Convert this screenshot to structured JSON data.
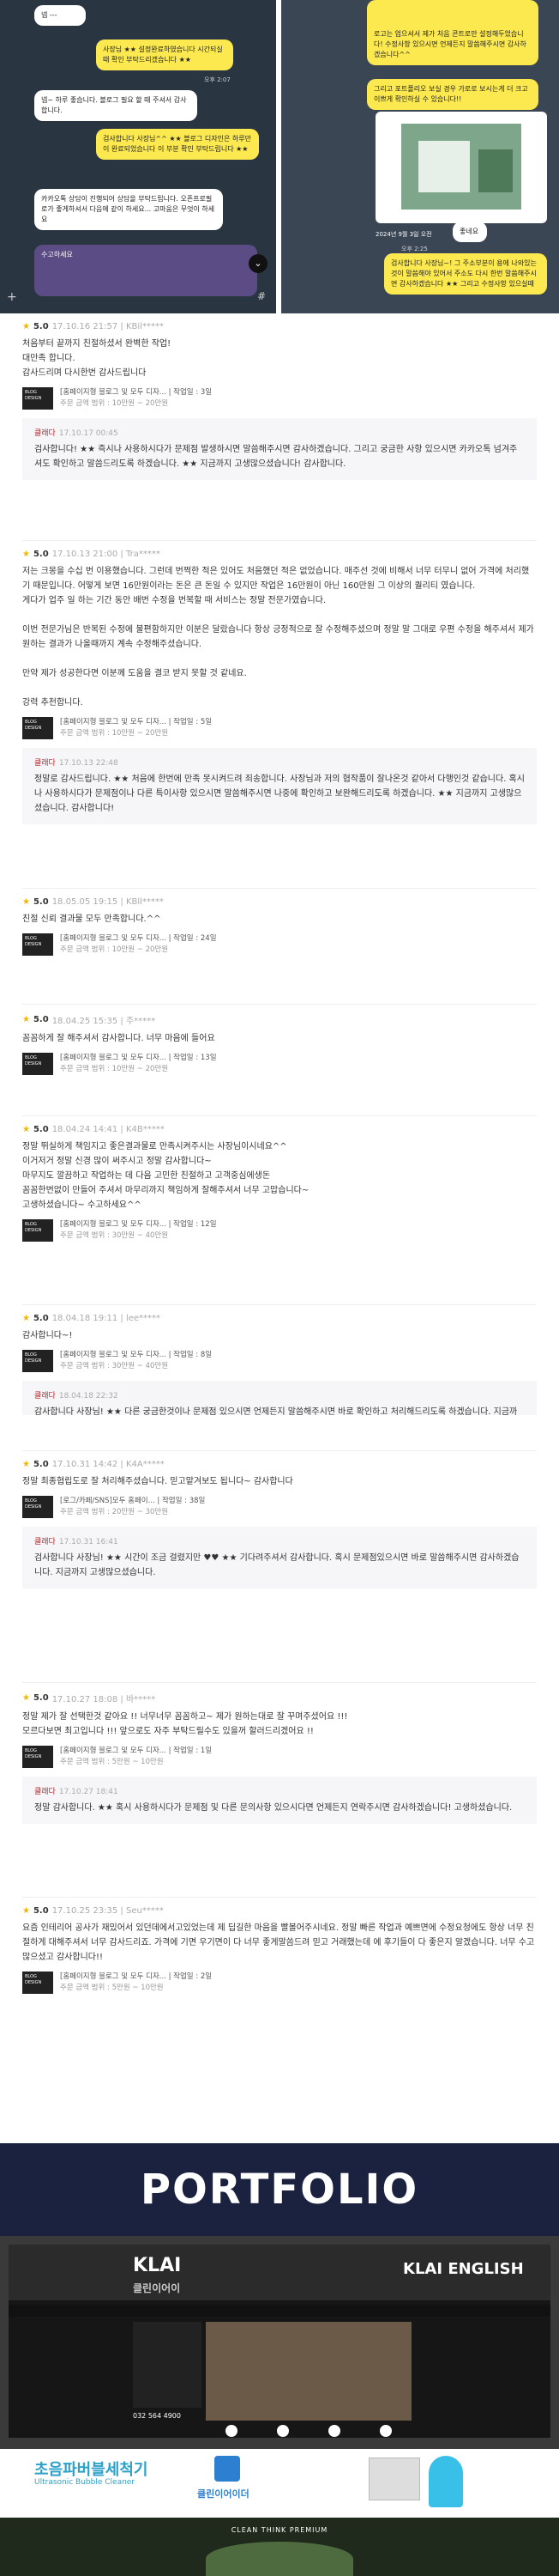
{
  "chat": {
    "left_messages": [
      "넵 ---",
      "사장님 ★★ 설정완료하였습니다 시간되실 때 확인 부탁드리겠습니다 ★★",
      "넵~ 하루 좋습니다. 블로그 필요 할 때 주셔서 감사합니다.",
      "검사합니다 사장님^^ ★★ 블로그 디자인은 하루만 이 완료되었습니다 이 부분 확인 부탁드립니다 ★★",
      "카카오톡 상담이 진행되어 상담을 부탁드립니다. 오픈프로필로가 좋게하셔서 다음에 같이 하세요... 고마움은 무엇이 하세요",
      "수고하세요"
    ],
    "right_messages": [
      "로고는 업으셔서 제가 처음 콘트로만 설정해두었습니다! 수정사항 있으시면 언제든지 말씀해주시면 감사하겠습니다^^",
      "그리고 포트폴리오 보실 경우 가로로 보시는게 더 크고 이쁘게 확인하실 수 있습니다!!",
      "좋네요",
      "검사합니다 사장님~! 그 주소부분이 용에 나와있는것이 말씀해야 있어서 주소도 다시 한번 말씀해주시면 감사하겠습니다 ★★ 그리고 수정사항 있으실때"
    ],
    "timestamps": [
      "오후 2:07",
      "오후 2:08",
      "오후 2:20",
      "오후 2:25"
    ],
    "date_label": "2024년 9월 3일 오전"
  },
  "reviews": [
    {
      "score": "5.0",
      "meta": "17.10.16 21:57 | KBil*****",
      "text": "처음부터 끝까지 친절하셨서 완벽한 작업!\n대만족 합니다.\n감사드리며 다시한번 감사드립니다",
      "product": "[홈페이지형 블로그 및 모두 디자...   | 작업일 : 3일",
      "price": "주문 금액 범위 : 10만원 ~ 20만원",
      "reply_who": "클래다",
      "reply_date": "17.10.17 00:45",
      "reply": "검사합니다! ★★ 즉시나 사용하시다가 문제점 발생하시면 말씀해주시면 감사하겠습니다. 그리고 궁금한 사항 있으시면 카카오톡 넘겨주셔도 확인하고 말씀드리도록 하겠습니다. ★★ 지금까지 고생많으셨습니다! 감사합니다."
    },
    {
      "score": "5.0",
      "meta": "17.10.13 21:00 | Tra*****",
      "text": "저는 크몽을 수십 번 이용했습니다. 그런데 번쩍한 적은 있어도 처음했던 적은 없었습니다. 매주선 것에 비해서 너무 터무니 없어 가격에 처리했기 때문입니다. 어떻게 보면 16만원이라는 돈은 큰 돈일 수 있지만 작업은 16만원이 아닌 160만원 그 이상의 퀄리티 였습니다.\n게다가 업주 일 하는 기간 동안 배번 수정을 번복할 때 서비스는 정말 전문가였습니다.\n\n이번 전문가님은 반복된 수정에 불편함하지만 이분은 달랐습니다 항상 긍정적으로 잘 수정해주셨으며 정말 말 그대로 우편 수정을 해주셔서 제가 원하는 결과가 나올때까지 계속 수정해주셨습니다.\n\n만약 제가 성공한다면 이분께 도움을 결코 받지 못할 것 같네요.\n\n강력 추천합니다.",
      "product": "[홈페이지형 블로그 및 모두 디자...   | 작업일 : 5일",
      "price": "주문 금액 범위 : 10만원 ~ 20만원",
      "reply_who": "클래다",
      "reply_date": "17.10.13 22:48",
      "reply": "정말로 감사드립니다. ★★ 처음에 한번에 만족 못시켜드려 죄송합니다. 사장님과 저의 협작품이 잘나온것 같아서 다행인것 같습니다. 혹시나 사용하시다가 문제점이나 다른 특이사항 있으시면 말씀해주시면 나중에 확인하고 보완해드리도록 하겠습니다. ★★ 지금까지 고생많으셨습니다. 감사합니다!"
    },
    {
      "score": "5.0",
      "meta": "18.05.05 19:15 | KBll*****",
      "text": "친절 신뢰 결과물 모두 만족합니다.^^",
      "product": "[홈페이지형 블로그 및 모두 디자...   | 작업일 : 24일",
      "price": "주문 금액 범위 : 10만원 ~ 20만원"
    },
    {
      "score": "5.0",
      "meta": "18.04.25 15:35 | 주*****",
      "text": "꼼꼼하게 잘 해주셔서 감사합니다. 너무 마음에 들어요",
      "product": "[홈페이지형 블로그 및 모두 디자...   | 작업일 : 13일",
      "price": "주문 금액 범위 : 10만원 ~ 20만원"
    },
    {
      "score": "5.0",
      "meta": "18.04.24 14:41 | K4B*****",
      "text": "정말 뛰실하게 책임지고 좋은결과물로 만족시켜주시는 사장님이시네요^^\n이거저거 정말 신경 많이 써주시고 정말 감사합니다~\n마무지도 깔끔하고 작업하는 데 다음 고민한 친절하고 고객중심에생돈 \n꼼꼼한번없이 만들어 주셔서 마무리까지 책임하게 잘해주셔서 너무 고맙습니다~\n고생하셨습니다~ 수고하세요^^",
      "product": "[홈페이지형 블로그 및 모두 디자...   | 작업일 : 12일",
      "price": "주문 금액 범위 : 30만원 ~ 40만원"
    },
    {
      "score": "5.0",
      "meta": "18.04.18 19:11 | lee*****",
      "text": "감사합니다~!",
      "product": "[홈페이지형 블로그 및 모두 디자...   | 작업일 : 8일",
      "price": "주문 금액 범위 : 30만원 ~ 40만원",
      "reply_who": "클래다",
      "reply_date": "18.04.18 22:32",
      "reply": "감사합니다 사장님! ★★ 다른 궁금한것이나 문제점 있으시면 언제든지 말씀해주시면 바로 확인하고 처리해드리도록 하겠습니다. 지금까"
    },
    {
      "score": "5.0",
      "meta": "17.10.31 14:42 | K4A*****",
      "text": "정말 최종협립도로 잘 처리해주셨습니다. 믿고맡겨보도 됩니다~ 감사합니다",
      "product": "[로그/카페/SNS]모두 홈페이...   | 작업일 : 38일",
      "price": "주문 금액 범위 : 20만원 ~ 30만원",
      "reply_who": "클래다",
      "reply_date": "17.10.31 16:41",
      "reply": "검사합니다 사장님! ★★ 시간이 조금 걸렸지만 ♥♥ ★★ 기다려주셔서 감사합니다. 혹시 문제점있으시면 바로 말씀해주시면 감사하겠습니다. 지금까지 고생많으셨습니다."
    },
    {
      "score": "5.0",
      "meta": "17.10.27 18:08 | 바*****",
      "text": "정말 제가 잘 선택한것 같아요 !! 너무너무 꼼꼼하고~ 제가 원하는대로 잘 꾸며주셨어요 !!!\n모르다보면 최고입니다 !!! 앞으로도 자주 부탁드릴수도 있을꺼 할러드리겠어요 !!",
      "product": "[홈페이지형 블로그 및 모두 디자...   | 작업일 : 1일",
      "price": "주문 금액 범위 : 5만원 ~ 10만원",
      "reply_who": "클래다",
      "reply_date": "17.10.27 18:41",
      "reply": "정말 감사합니다. ★★ 혹시 사용하시다가 문제점 및 다른 문의사항 있으시다면 언제든지 연락주시면 감사하겠습니다! 고생하셨습니다."
    },
    {
      "score": "5.0",
      "meta": "17.10.25 23:35 | Seu*****",
      "text": "요즘 인테리어 공사가 재밌어서 있던데에서고있었는데 제 딥길한 마음을 빨볼어주시네요. 정말 빠른 작업과 예쁘면에 수정요청에도 항상 너무 친절하게 대해주셔서 너무 감사드리죠. 가격에 기면 우기면이 다 너무 좋게말씀드려 믿고 거래했는데 에 후기들이 다 좋은지 알겠습니다. 너무 수고 많으셨고 감사합니다!!",
      "product": "[홈페이지형 블로그 및 모두 디자...   | 작업일 : 2일",
      "price": "주문 금액 범위 : 5만원 ~ 10만원"
    }
  ],
  "portfolio": {
    "title": "PORTFOLIO",
    "sample1_logo": "KLAI",
    "sample1_sub": "클린이어이",
    "sample1_brand": "KLAI ENGLISH",
    "sample1_phone": "032 564 4900",
    "sample2_title": "초음파버블세척기",
    "sample2_sub": "Ultrasonic Bubble Cleaner",
    "sample2_brand": "클린이어이더",
    "sample3_caption": "CLEAN THINK PREMIUM"
  },
  "colors": {
    "star": "#f2b600",
    "reply_author": "#b3262b",
    "banner_bg": "#1a2240",
    "chat_yellow": "#fce94f"
  }
}
